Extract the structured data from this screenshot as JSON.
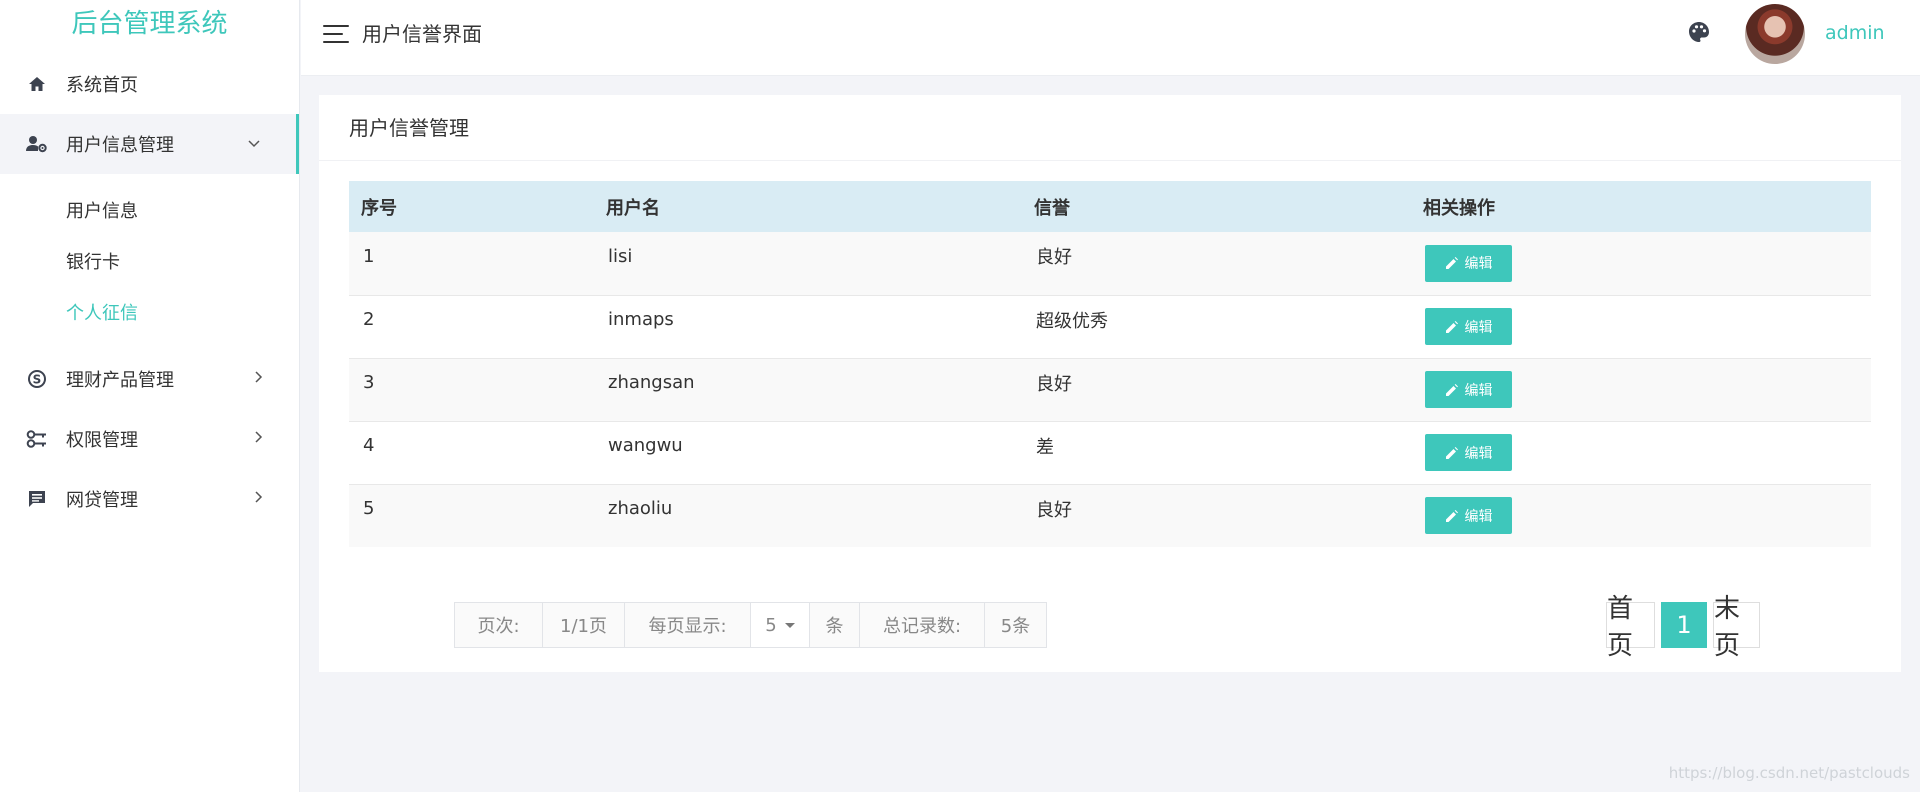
{
  "app": {
    "title": "后台管理系统"
  },
  "sidebar": {
    "items": [
      {
        "label": "系统首页"
      },
      {
        "label": "用户信息管理",
        "children": [
          "用户信息",
          "银行卡",
          "个人征信"
        ]
      },
      {
        "label": "理财产品管理"
      },
      {
        "label": "权限管理"
      },
      {
        "label": "网贷管理"
      }
    ],
    "active_child": "个人征信"
  },
  "header": {
    "page_title": "用户信誉界面",
    "username": "admin"
  },
  "card": {
    "title": "用户信誉管理",
    "table": {
      "columns": [
        "序号",
        "用户名",
        "信誉",
        "相关操作"
      ],
      "rows": [
        {
          "id": "1",
          "username": "lisi",
          "credit": "良好"
        },
        {
          "id": "2",
          "username": "inmaps",
          "credit": "超级优秀"
        },
        {
          "id": "3",
          "username": "zhangsan",
          "credit": "良好"
        },
        {
          "id": "4",
          "username": "wangwu",
          "credit": "差"
        },
        {
          "id": "5",
          "username": "zhaoliu",
          "credit": "良好"
        }
      ],
      "edit_label": "编辑"
    }
  },
  "pagination": {
    "page_label": "页次:",
    "page_value": "1/1页",
    "per_page_label": "每页显示:",
    "per_page_value": "5",
    "per_page_unit": "条",
    "total_label": "总记录数:",
    "total_value": "5条",
    "first": "首页",
    "current": "1",
    "last": "末页"
  },
  "watermark": "https://blog.csdn.net/pastclouds",
  "colors": {
    "accent": "#3ec7bb",
    "table_header": "#d9ecf4"
  }
}
